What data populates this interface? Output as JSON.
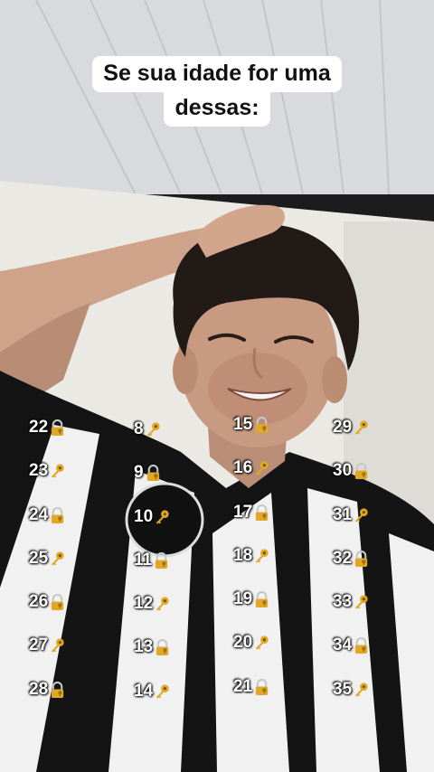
{
  "caption": {
    "line1": "Se sua idade for uma",
    "line2": "dessas:"
  },
  "emoji": {
    "lock": "locked-with-key-icon",
    "key": "key-icon"
  },
  "columns": [
    {
      "items": [
        {
          "age": "22",
          "emoji": "lock"
        },
        {
          "age": "23",
          "emoji": "key"
        },
        {
          "age": "24",
          "emoji": "lock"
        },
        {
          "age": "25",
          "emoji": "key"
        },
        {
          "age": "26",
          "emoji": "lock"
        },
        {
          "age": "27",
          "emoji": "key"
        },
        {
          "age": "28",
          "emoji": "lock"
        }
      ]
    },
    {
      "items": [
        {
          "age": "8",
          "emoji": "key"
        },
        {
          "age": "9",
          "emoji": "lock"
        },
        {
          "age": "10",
          "emoji": "key"
        },
        {
          "age": "11",
          "emoji": "lock"
        },
        {
          "age": "12",
          "emoji": "key"
        },
        {
          "age": "13",
          "emoji": "lock"
        },
        {
          "age": "14",
          "emoji": "key"
        }
      ]
    },
    {
      "items": [
        {
          "age": "15",
          "emoji": "lock"
        },
        {
          "age": "16",
          "emoji": "key"
        },
        {
          "age": "17",
          "emoji": "lock"
        },
        {
          "age": "18",
          "emoji": "key"
        },
        {
          "age": "19",
          "emoji": "lock"
        },
        {
          "age": "20",
          "emoji": "key"
        },
        {
          "age": "21",
          "emoji": "lock"
        }
      ]
    },
    {
      "items": [
        {
          "age": "29",
          "emoji": "key"
        },
        {
          "age": "30",
          "emoji": "lock"
        },
        {
          "age": "31",
          "emoji": "key"
        },
        {
          "age": "32",
          "emoji": "lock"
        },
        {
          "age": "33",
          "emoji": "key"
        },
        {
          "age": "34",
          "emoji": "lock"
        },
        {
          "age": "35",
          "emoji": "key"
        }
      ]
    }
  ],
  "colors": {
    "ceiling": "#dcdde0",
    "wall": "#eceae5",
    "hair": "#221a16",
    "skin": "#c99a82",
    "jersey_black": "#141414",
    "jersey_white": "#f2f2f2",
    "emoji_gold": "#e0a826"
  }
}
